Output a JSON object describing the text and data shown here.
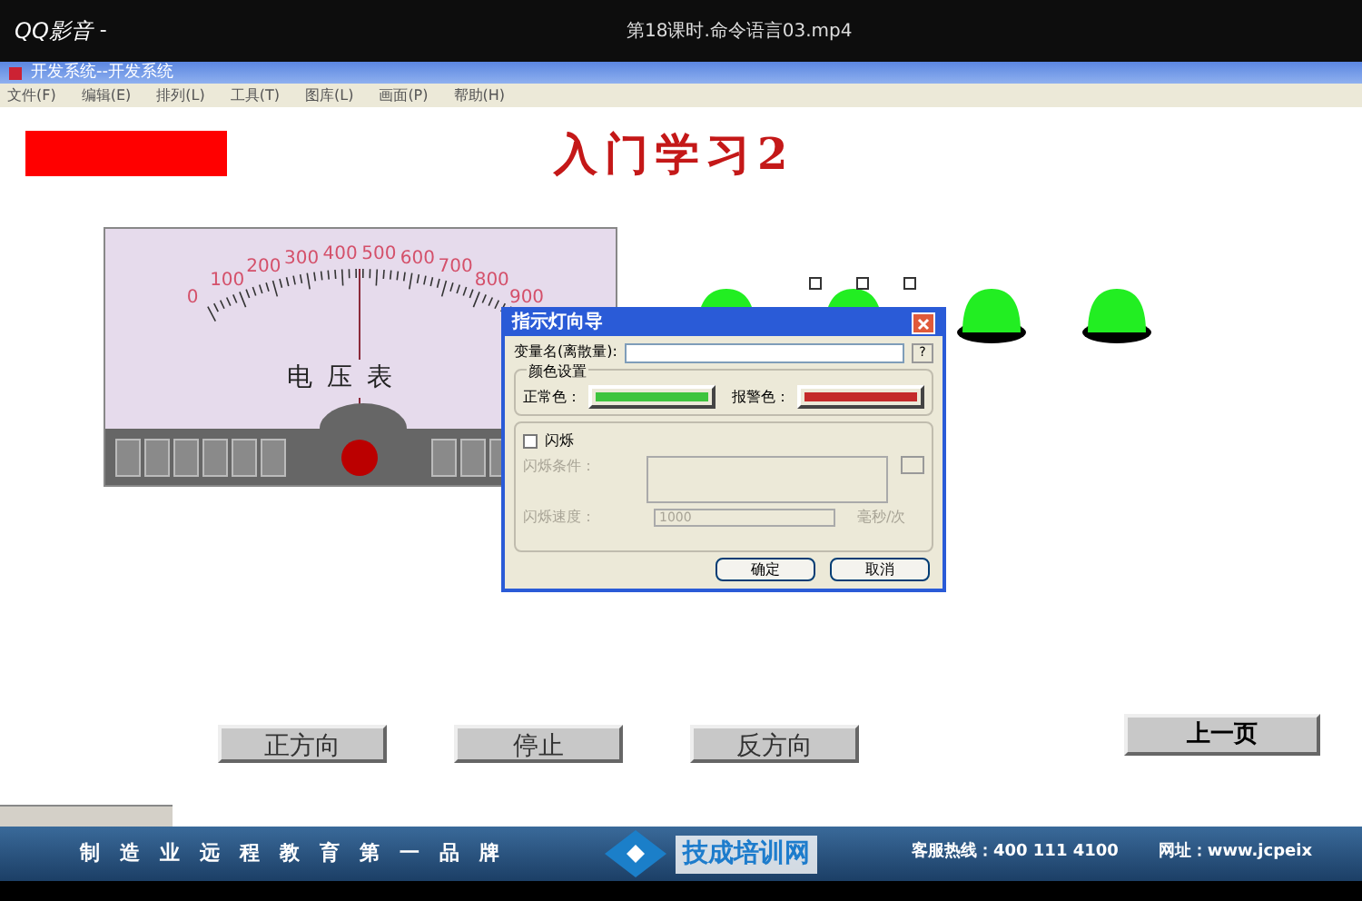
{
  "player": {
    "logo": "QQ影音",
    "menu_mark": "-",
    "file_title": "第18课时.命令语言03.mp4"
  },
  "window": {
    "title": "开发系统--开发系统"
  },
  "menu": [
    "文件(F)",
    "编辑(E)",
    "排列(L)",
    "工具(T)",
    "图库(L)",
    "画面(P)",
    "帮助(H)"
  ],
  "screen": {
    "heading": "入门学习2",
    "meter": {
      "label": "电压表",
      "scale": [
        "0",
        "100",
        "200",
        "300",
        "400",
        "500",
        "600",
        "700",
        "800",
        "900"
      ]
    },
    "buttons": [
      "正方向",
      "停止",
      "反方向"
    ],
    "page_button": "上一页"
  },
  "dialog": {
    "title": "指示灯向导",
    "variable_label": "变量名(离散量):",
    "browse": "?",
    "group_label": "颜色设置",
    "colors": [
      {
        "label": "正常色：",
        "color": "#3ec43e"
      },
      {
        "label": "报警色：",
        "color": "#c42a2a"
      }
    ],
    "blink": {
      "label": "闪烁",
      "checked": false,
      "condition_label": "闪烁条件：",
      "speed_label": "闪烁速度：",
      "speed_value": "1000",
      "speed_unit": "毫秒/次"
    },
    "buttons": [
      "确定",
      "取消"
    ]
  },
  "banner": {
    "slogan": "制造业远程教育第一品牌",
    "brand": "技成培训网",
    "hotline": "客服热线：400 111 4100",
    "website": "网址：www.jcpeix"
  }
}
